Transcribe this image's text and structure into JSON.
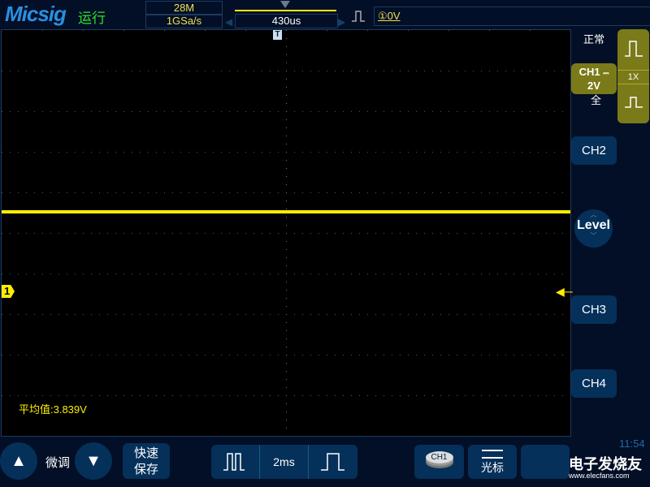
{
  "header": {
    "brand": "Micsig",
    "run_state": "运行",
    "memory_depth": "28M",
    "sample_rate": "1GSa/s",
    "time_offset": "430us",
    "trigger_channel_level": "①0V"
  },
  "right_panel": {
    "trigger_mode": "正常",
    "ch1_label": "CH1",
    "ch1_scale": "2V",
    "ch1_bandwidth": "全",
    "probe": "1X",
    "ch2": "CH2",
    "level": "Level",
    "ch3": "CH3",
    "ch4": "CH4",
    "time": "11:54"
  },
  "screen": {
    "channel_marker": "1",
    "trigger_marker": "T",
    "measurement": "平均值:3.839V",
    "trace_color": "#ffee00"
  },
  "bottom": {
    "fine_label": "微调",
    "quick_save": [
      "快速",
      "保存"
    ],
    "timebase": "2ms",
    "ch1_button": "CH1",
    "cursor": "光标"
  },
  "watermark": {
    "text": "电子发烧友",
    "url": "www.elecfans.com"
  }
}
